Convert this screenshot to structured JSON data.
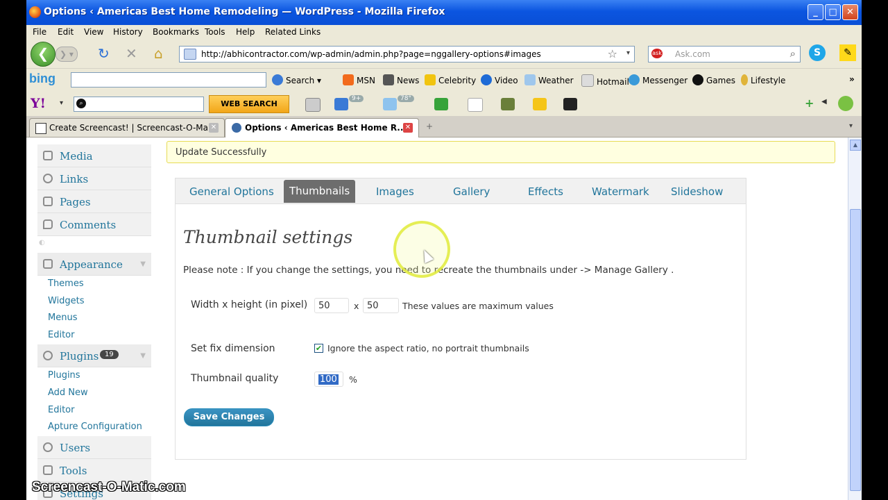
{
  "window": {
    "title": "Options ‹ Americas Best Home Remodeling — WordPress - Mozilla Firefox",
    "minimize": "_",
    "maximize": "□",
    "close": "✕"
  },
  "menu": [
    "File",
    "Edit",
    "View",
    "History",
    "Bookmarks",
    "Tools",
    "Help",
    "Related Links"
  ],
  "nav": {
    "url": "http://abhicontractor.com/wp-admin/admin.php?page=nggallery-options#images",
    "search_placeholder": "Ask.com"
  },
  "bing_bar": {
    "logo": "bing",
    "items": [
      "Search",
      "MSN",
      "News",
      "Celebrity",
      "Video",
      "Weather",
      "Hotmail",
      "Messenger",
      "Games",
      "Lifestyle"
    ]
  },
  "yahoo_bar": {
    "logo": "Y!",
    "web_search": "WEB SEARCH",
    "mail_badge": "9+",
    "weather_badge": "78°"
  },
  "tabs": [
    {
      "label": "Create Screencast! | Screencast-O-Ma...",
      "active": false
    },
    {
      "label": "Options ‹ Americas Best Home R...",
      "active": true
    }
  ],
  "sidebar": {
    "top_items": [
      "Media",
      "Links",
      "Pages",
      "Comments"
    ],
    "appearance": {
      "label": "Appearance",
      "subitems": [
        "Themes",
        "Widgets",
        "Menus",
        "Editor"
      ]
    },
    "plugins": {
      "label": "Plugins",
      "badge": "19",
      "subitems": [
        "Plugins",
        "Add New",
        "Editor",
        "Apture Configuration"
      ]
    },
    "bottom_items": [
      "Users",
      "Tools",
      "Settings"
    ]
  },
  "notice": "Update Successfully",
  "options": {
    "tabs": [
      "General Options",
      "Thumbnails",
      "Images",
      "Gallery",
      "Effects",
      "Watermark",
      "Slideshow"
    ],
    "active_tab": "Thumbnails",
    "title": "Thumbnail settings",
    "note": "Please note : If you change the settings, you need to recreate the thumbnails under -> Manage Gallery .",
    "width_height_label": "Width x height (in pixel)",
    "width_value": "50",
    "separator": "x",
    "height_value": "50",
    "max_note": "These values are maximum values",
    "fix_dimension_label": "Set fix dimension",
    "fix_dimension_checked": true,
    "fix_dimension_note": "Ignore the aspect ratio, no portrait thumbnails",
    "quality_label": "Thumbnail quality",
    "quality_value": "100",
    "quality_unit": "%",
    "save_button": "Save Changes"
  },
  "watermark": "Screencast-O-Matic.com"
}
